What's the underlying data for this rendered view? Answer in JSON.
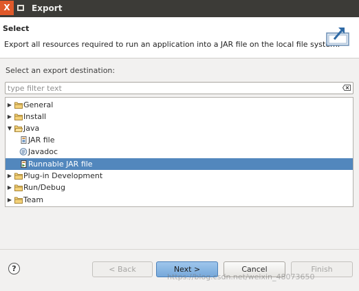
{
  "window": {
    "title": "Export",
    "close_glyph": "X"
  },
  "header": {
    "title": "Select",
    "description": "Export all resources required to run an application into a JAR file on the local file system."
  },
  "destination_label": "Select an export destination:",
  "filter": {
    "placeholder": "type filter text",
    "value": ""
  },
  "tree": {
    "items": [
      {
        "label": "General",
        "expanded": false,
        "icon": "folder-icon"
      },
      {
        "label": "Install",
        "expanded": false,
        "icon": "folder-icon"
      },
      {
        "label": "Java",
        "expanded": true,
        "icon": "folder-icon"
      },
      {
        "label": "JAR file",
        "icon": "jar-file-icon"
      },
      {
        "label": "Javadoc",
        "icon": "javadoc-icon"
      },
      {
        "label": "Runnable JAR file",
        "icon": "runnable-jar-icon",
        "selected": true
      },
      {
        "label": "Plug-in Development",
        "expanded": false,
        "icon": "folder-icon"
      },
      {
        "label": "Run/Debug",
        "expanded": false,
        "icon": "folder-icon"
      },
      {
        "label": "Team",
        "expanded": false,
        "icon": "folder-icon"
      }
    ]
  },
  "buttons": {
    "help": "?",
    "back": "< Back",
    "next": "Next >",
    "cancel": "Cancel",
    "finish": "Finish"
  },
  "watermark": "https://blog.csdn.net/weixin_48073650",
  "colors": {
    "selection": "#5287bd",
    "titlebar": "#3c3b37",
    "close": "#e0592a"
  }
}
